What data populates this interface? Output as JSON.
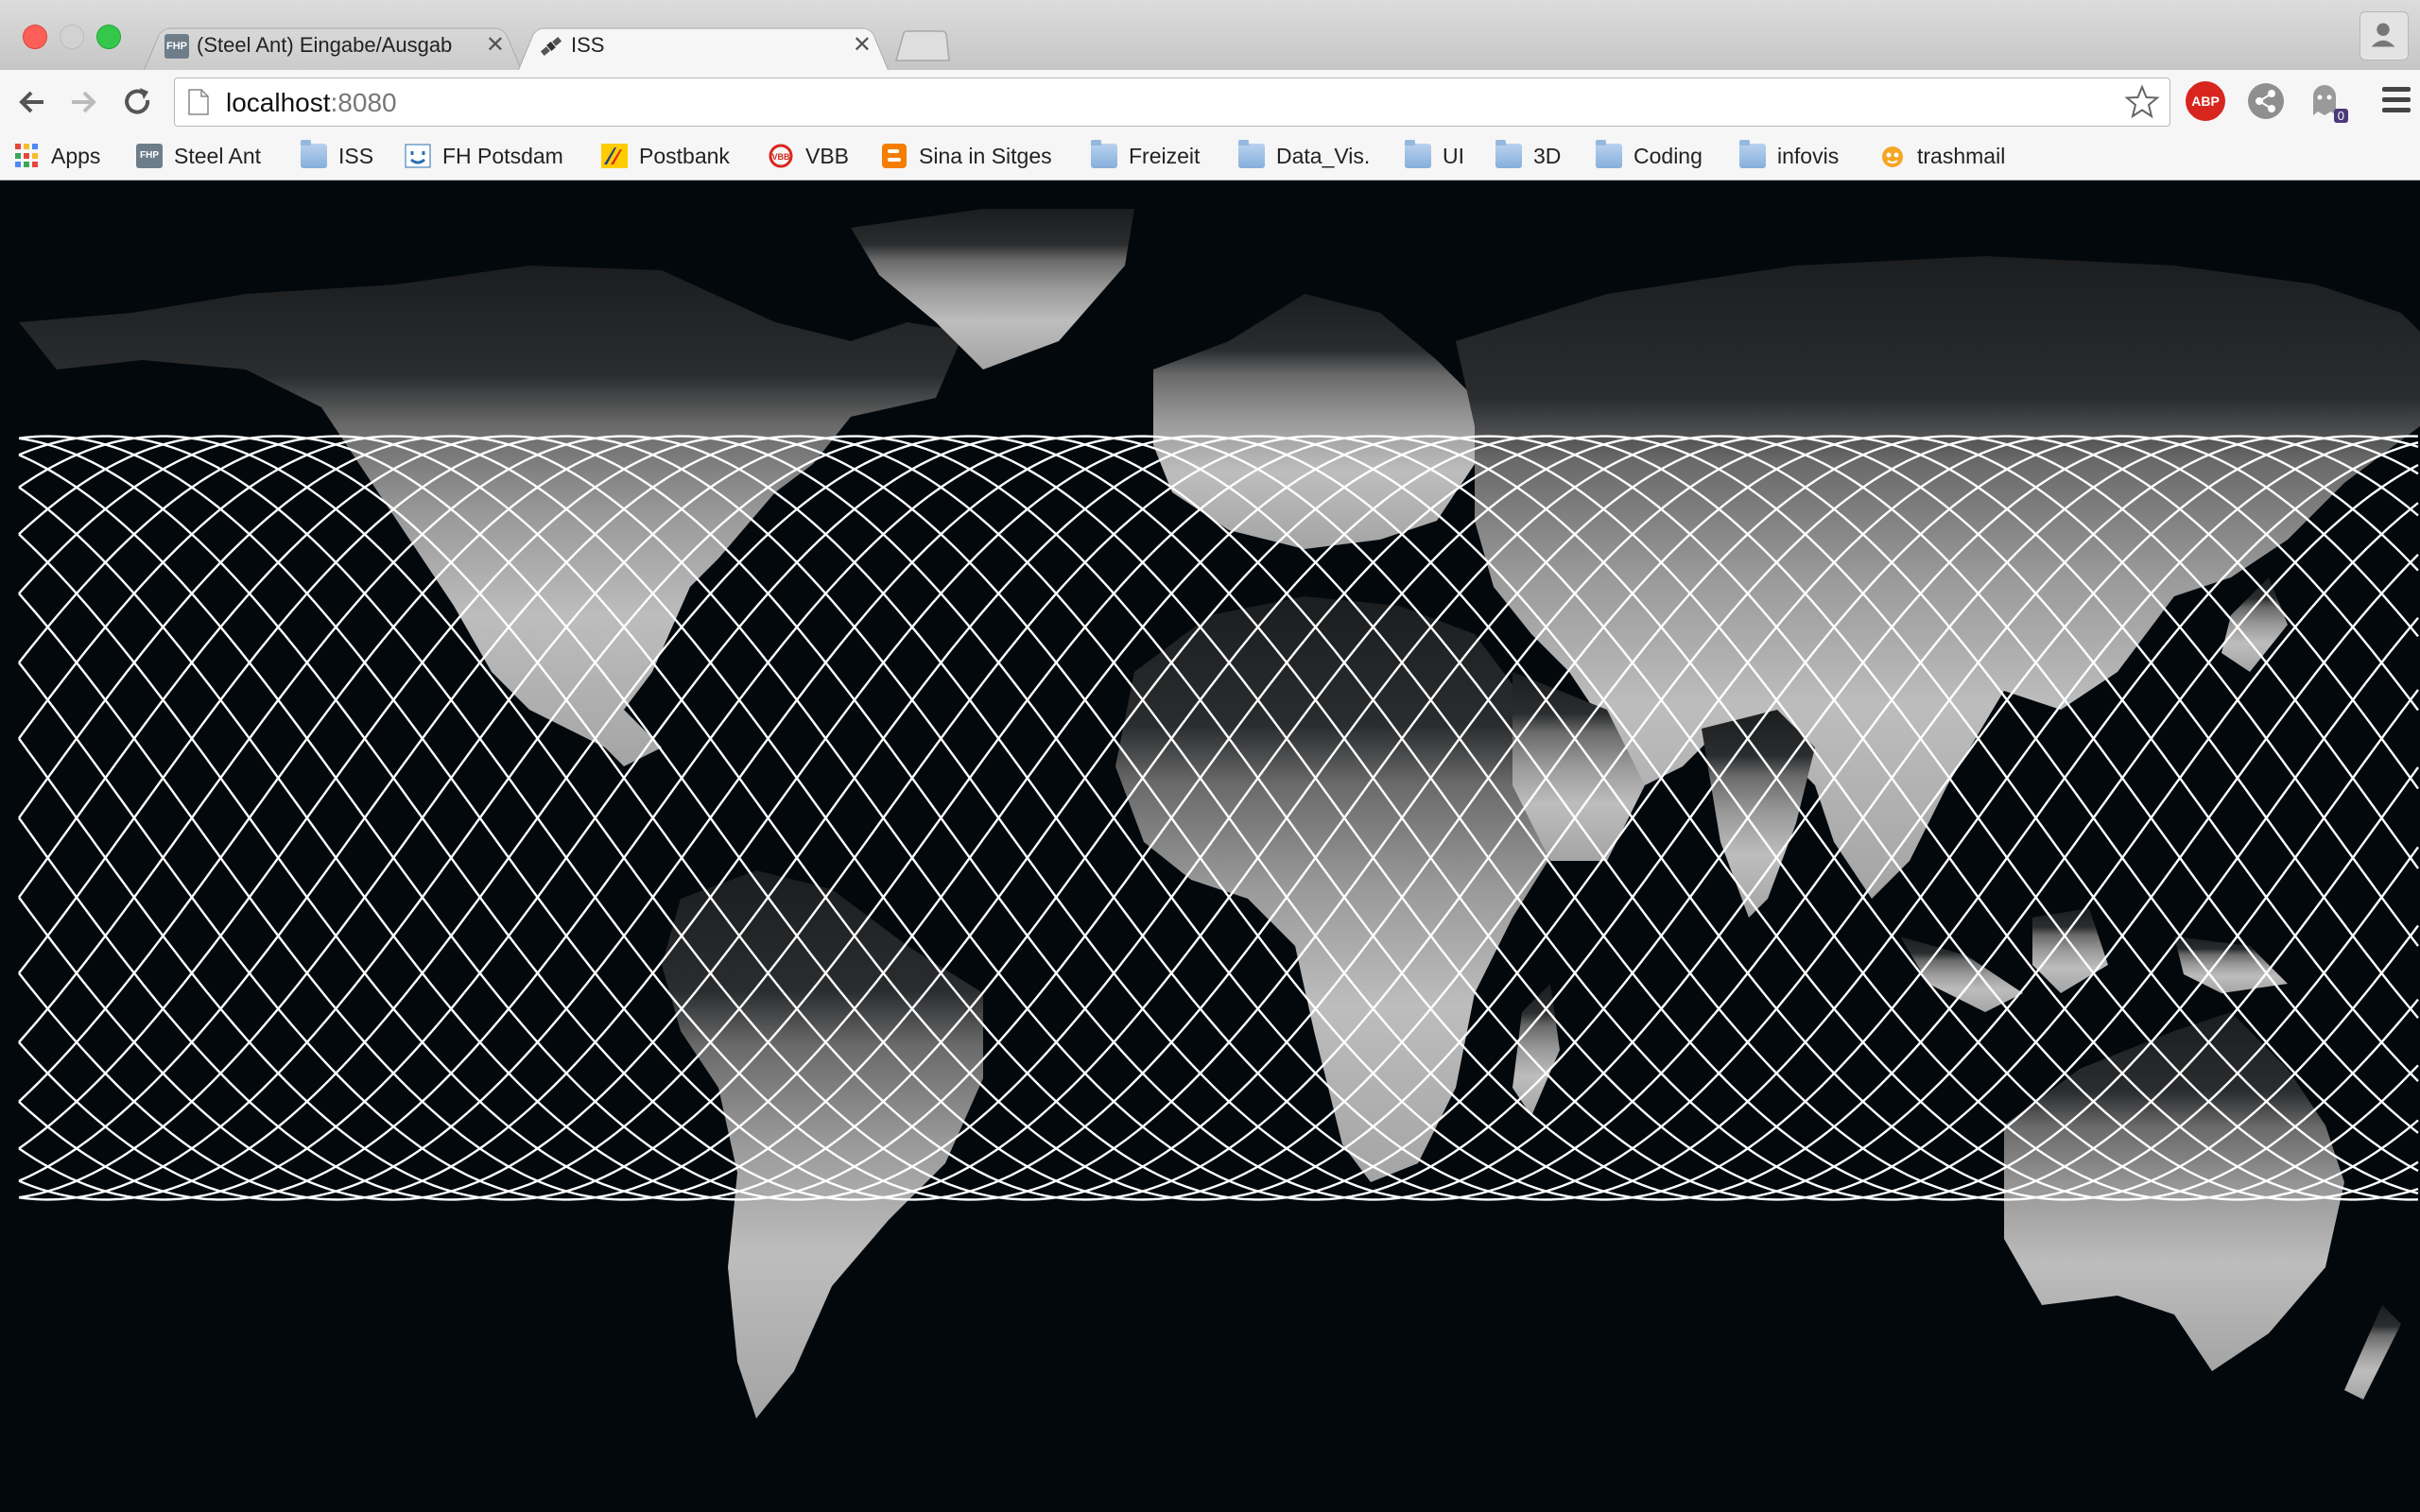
{
  "browser": {
    "tabs": [
      {
        "title": "(Steel Ant) Eingabe/Ausgab",
        "favicon": "fhp-icon",
        "favicon_text": "FHP",
        "active": false
      },
      {
        "title": "ISS",
        "favicon": "satellite-icon",
        "active": true
      }
    ],
    "address": {
      "host": "localhost",
      "port": ":8080"
    },
    "extensions": [
      {
        "name": "adblock-plus-icon",
        "label": "ABP"
      },
      {
        "name": "share-extension-icon"
      },
      {
        "name": "ghostery-icon",
        "badge": "0"
      }
    ]
  },
  "bookmarks": [
    {
      "label": "Apps",
      "icon": "apps-grid-icon"
    },
    {
      "label": "Steel Ant",
      "icon": "fhp-icon",
      "icon_text": "FHP"
    },
    {
      "label": "ISS",
      "icon": "folder-icon"
    },
    {
      "label": "FH Potsdam",
      "icon": "fh-potsdam-icon"
    },
    {
      "label": "Postbank",
      "icon": "postbank-icon"
    },
    {
      "label": "VBB",
      "icon": "vbb-icon"
    },
    {
      "label": "Sina in Sitges",
      "icon": "blogger-icon"
    },
    {
      "label": "Freizeit",
      "icon": "folder-icon"
    },
    {
      "label": "Data_Vis.",
      "icon": "folder-icon"
    },
    {
      "label": "UI",
      "icon": "folder-icon"
    },
    {
      "label": "3D",
      "icon": "folder-icon"
    },
    {
      "label": "Coding",
      "icon": "folder-icon"
    },
    {
      "label": "infovis",
      "icon": "folder-icon"
    },
    {
      "label": "trashmail",
      "icon": "trashmail-icon"
    }
  ],
  "visualization": {
    "description_map": "world-map-equirectangular",
    "track_color": "#ffffff",
    "land_color_bright": "#bdbdbd",
    "land_color_dark": "#1b1d1f",
    "ocean_color": "#03080c",
    "orbit_inclination_deg": 51.6,
    "orbit_count": 30
  }
}
